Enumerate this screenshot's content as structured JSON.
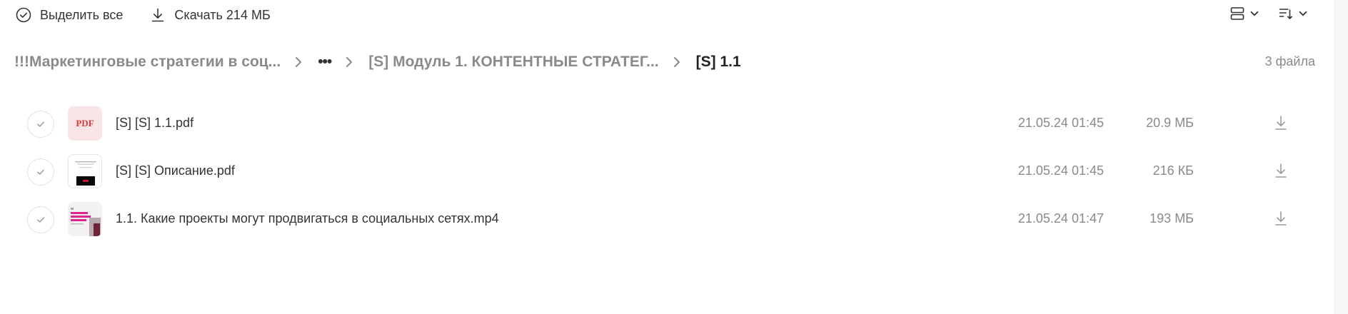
{
  "toolbar": {
    "select_all_label": "Выделить все",
    "download_label": "Скачать 214 МБ"
  },
  "breadcrumbs": {
    "root": "!!!Маркетинговые стратегии в соц...",
    "more": "•••",
    "module": "[S] Модуль 1. КОНТЕНТНЫЕ СТРАТЕГ...",
    "current": "[S] 1.1"
  },
  "file_count": "3 файла",
  "files": [
    {
      "name": "[S] [S] 1.1.pdf",
      "date": "21.05.24 01:45",
      "size": "20.9 МБ",
      "thumb_type": "pdf",
      "thumb_label": "PDF"
    },
    {
      "name": "[S] [S] Описание.pdf",
      "date": "21.05.24 01:45",
      "size": "216 КБ",
      "thumb_type": "doc-preview"
    },
    {
      "name": "1.1. Какие проекты могут продвигаться в социальных сетях.mp4",
      "date": "21.05.24 01:47",
      "size": "193 МБ",
      "thumb_type": "video-preview"
    }
  ],
  "icons": {
    "select_all": "check-circle-icon",
    "download": "download-icon",
    "view_mode": "view-layout-icon",
    "sort": "sort-icon",
    "chevron": "chevron-down-icon",
    "breadcrumb_separator": "chevron-right-icon"
  },
  "colors": {
    "text": "#333333",
    "muted": "#8a8a8a",
    "pdf_bg": "#fbe4e6",
    "pdf_text": "#d23a3a",
    "video_accent": "#e0258e"
  }
}
